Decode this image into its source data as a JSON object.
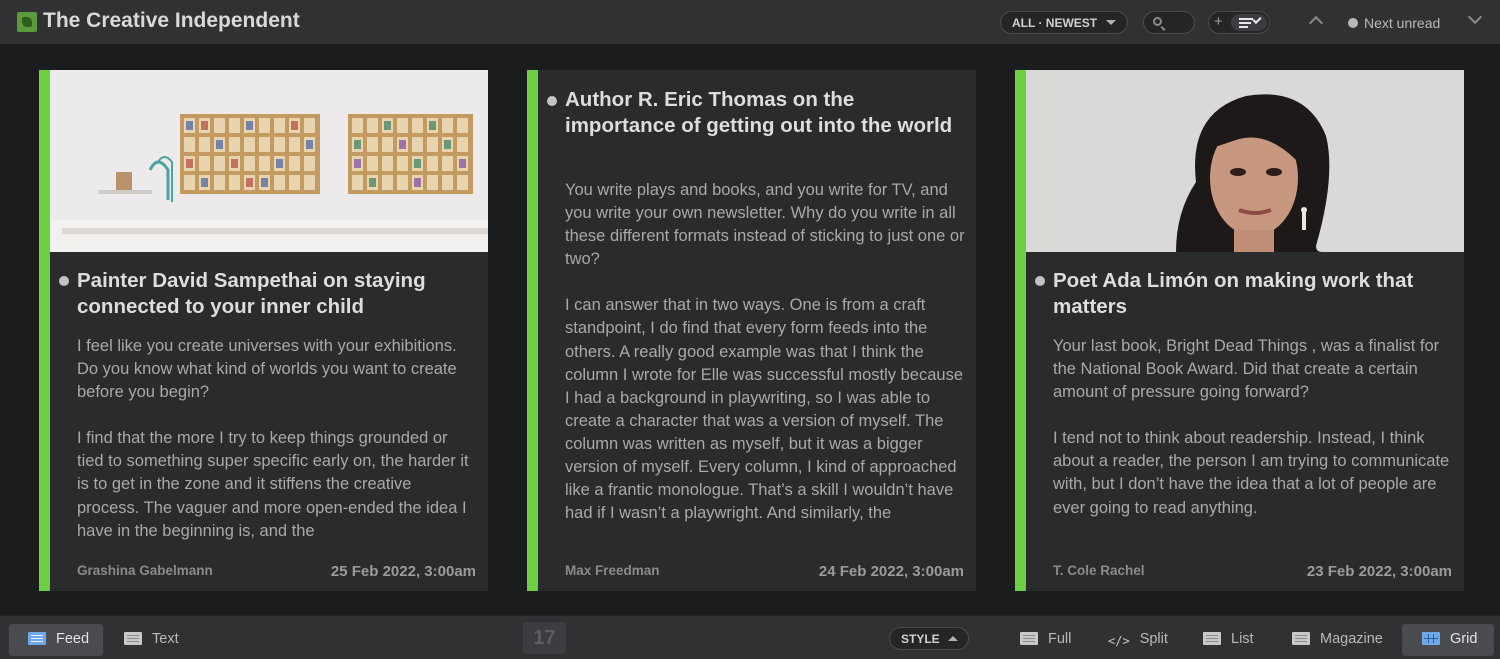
{
  "header": {
    "feed_title": "The Creative Independent",
    "order_label": "ALL · NEWEST",
    "next_unread_label": "Next unread"
  },
  "stories": [
    {
      "title": "Painter David Sampethai on staying connected to your inner child",
      "excerpt": [
        "I feel like you create universes with your exhibitions. Do you know what kind of worlds you want to create before you begin?",
        "I find that the more I try to keep things grounded or tied to something super specific early on, the harder it is to get in the zone and it stiffens the creative process. The vaguer and more open-ended the idea I have in the beginning is, and the"
      ],
      "author": "Grashina Gabelmann",
      "date": "25 Feb 2022, 3:00am",
      "has_image": true
    },
    {
      "title": "Author R. Eric Thomas on the importance of getting out into the world",
      "excerpt": [
        "You write plays and books, and you write for TV, and you write your own newsletter. Why do you write in all these different formats instead of sticking to just one or two?",
        "I can answer that in two ways. One is from a craft standpoint, I do find that every form feeds into the others. A really good example was that I think the column I wrote for Elle was successful mostly because I had a background in playwriting, so I was able to create a character that was a version of myself. The column was written as myself, but it was a bigger version of myself. Every column, I kind of approached like a frantic monologue. That’s a skill I wouldn’t have had if I wasn’t a playwright. And similarly, the"
      ],
      "author": "Max Freedman",
      "date": "24 Feb 2022, 3:00am",
      "has_image": false
    },
    {
      "title": "Poet Ada Limón on making work that matters",
      "excerpt": [
        "Your last book, Bright Dead Things , was a finalist for the National Book Award. Did that create a certain amount of pressure going forward?",
        "I tend not to think about readership. Instead, I think about a reader, the person I am trying to communicate with, but I don’t have the idea that a lot of people are ever going to read anything."
      ],
      "author": "T. Cole Rachel",
      "date": "23 Feb 2022, 3:00am",
      "has_image": true
    }
  ],
  "footer": {
    "feed_label": "Feed",
    "text_label": "Text",
    "unread_count": "17",
    "style_label": "STYLE",
    "full_label": "Full",
    "split_label": "Split",
    "list_label": "List",
    "magazine_label": "Magazine",
    "grid_label": "Grid"
  },
  "colors": {
    "accent_green": "#6fcf44",
    "active_blue": "#6fa8e8"
  }
}
